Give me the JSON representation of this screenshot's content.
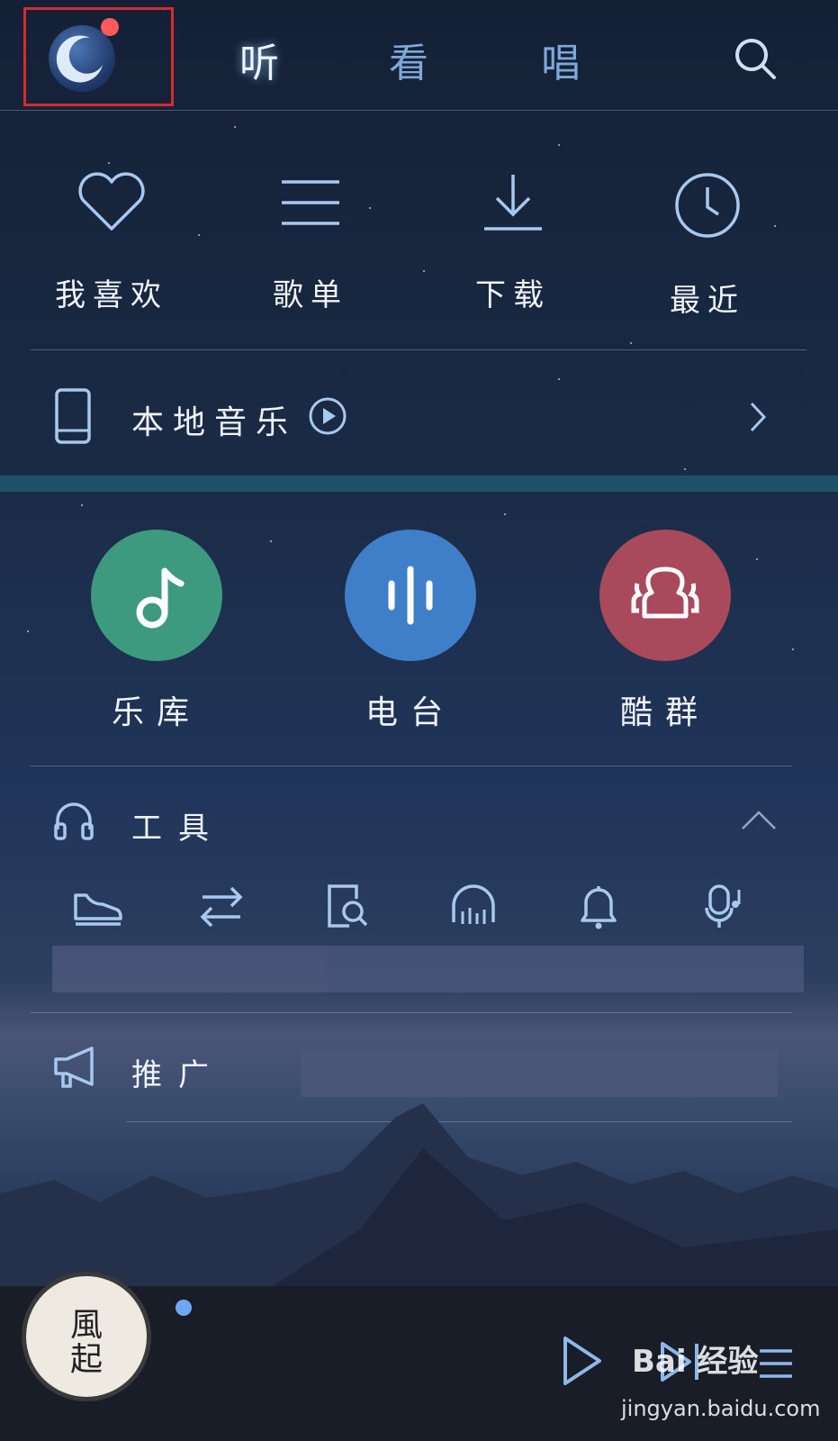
{
  "header": {
    "tabs": [
      {
        "label": "听",
        "active": true
      },
      {
        "label": "看",
        "active": false
      },
      {
        "label": "唱",
        "active": false
      }
    ],
    "notification_color": "#ff5a5a",
    "highlight_box_color": "#d62b2b",
    "search_icon": "search-icon",
    "avatar_icon": "crescent-moon-icon"
  },
  "quick_access": [
    {
      "label": "我喜欢",
      "icon": "heart-icon"
    },
    {
      "label": "歌单",
      "icon": "list-icon"
    },
    {
      "label": "下载",
      "icon": "download-icon"
    },
    {
      "label": "最近",
      "icon": "clock-icon"
    }
  ],
  "local_music": {
    "label": "本地音乐",
    "icon": "phone-icon",
    "play_icon": "play-circle-icon",
    "arrow_icon": "chevron-right-icon"
  },
  "features": [
    {
      "label": "乐库",
      "icon": "music-note-icon",
      "color": "#3e9a7e"
    },
    {
      "label": "电台",
      "icon": "audio-bars-icon",
      "color": "#3f7fca"
    },
    {
      "label": "酷群",
      "icon": "group-icon",
      "color": "#a94a5c"
    }
  ],
  "tools": {
    "label": "工具",
    "icon": "headphones-icon",
    "collapse_icon": "chevron-up-icon",
    "items": [
      {
        "icon": "sneaker-icon"
      },
      {
        "icon": "transfer-arrows-icon"
      },
      {
        "icon": "document-search-icon"
      },
      {
        "icon": "equalizer-headphones-icon"
      },
      {
        "icon": "bell-icon"
      },
      {
        "icon": "mic-note-icon"
      }
    ]
  },
  "promotion": {
    "label": "推广",
    "icon": "megaphone-icon"
  },
  "player": {
    "album_text_1": "風",
    "album_text_2": "起",
    "play_icon": "play-icon",
    "next_icon": "next-icon",
    "playlist_icon": "playlist-icon",
    "progress_color": "#6fa8f2"
  },
  "watermark": {
    "brand": "Bai 经验",
    "url": "jingyan.baidu.com"
  }
}
